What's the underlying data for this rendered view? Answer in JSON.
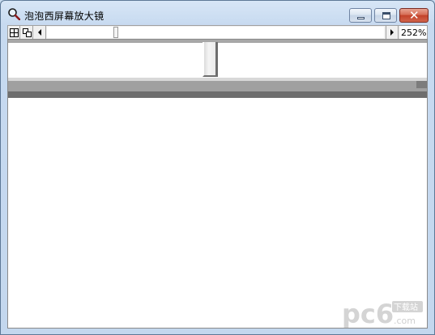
{
  "window": {
    "title": "泡泡西屏幕放大镜",
    "icon": "magnifier-icon"
  },
  "caption_buttons": {
    "minimize": "minimize-icon",
    "maximize": "maximize-icon",
    "close": "close-icon"
  },
  "toolbar": {
    "buttons": [
      "grid-icon",
      "copy-window-icon",
      "arrow-left-icon",
      "arrow-right-icon"
    ],
    "zoom_label": "252%",
    "zoom_slider_fraction": 0.2
  },
  "watermark": {
    "text": "pc6",
    "badge": "下载站",
    "suffix": ".com"
  },
  "colors": {
    "titlebar": "#c7daf0",
    "close_button": "#c3422a",
    "watermark": "#c8c8c8"
  }
}
